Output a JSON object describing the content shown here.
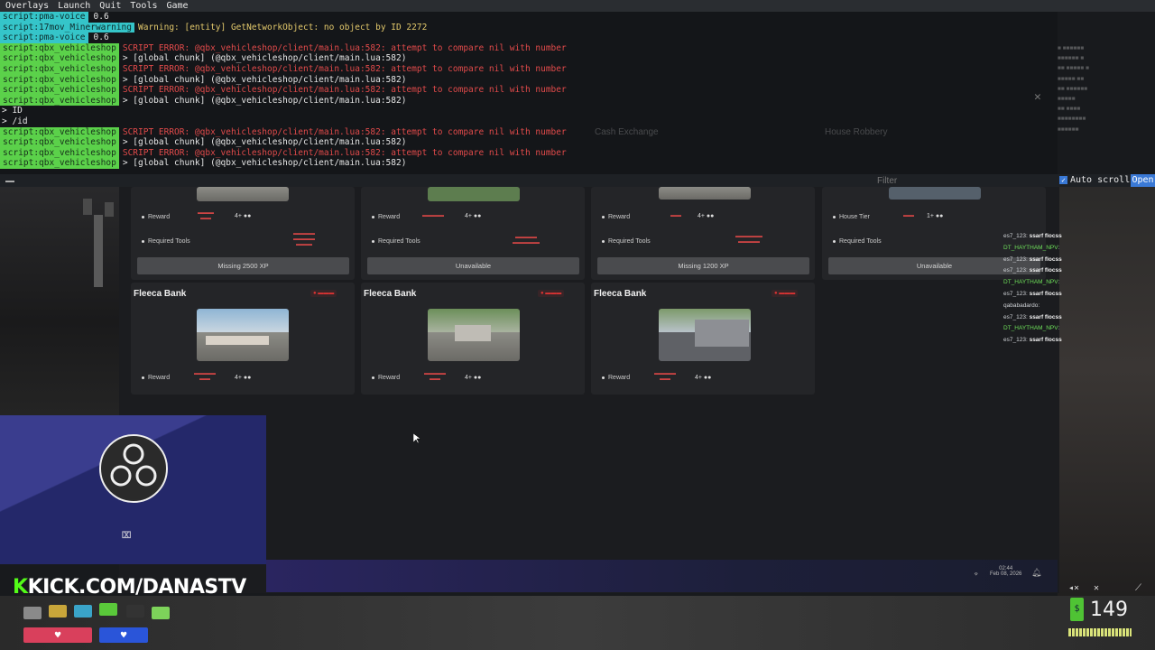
{
  "menu": [
    "Overlays",
    "Launch",
    "Quit",
    "Tools",
    "Game"
  ],
  "console": {
    "lines": [
      {
        "tag": "script:pma-voice",
        "tag_color": "cyan",
        "text": "0.6",
        "kind": "plain"
      },
      {
        "tag": "script:17mov_Minerwarning",
        "tag_color": "cyan",
        "text": "Warning: [entity] GetNetworkObject: no object by ID 2272",
        "kind": "warn"
      },
      {
        "tag": "script:pma-voice",
        "tag_color": "cyan",
        "text": "0.6",
        "kind": "plain"
      },
      {
        "tag": "script:qbx_vehicleshop",
        "tag_color": "green",
        "text": "SCRIPT ERROR: @qbx_vehicleshop/client/main.lua:582: attempt to compare nil with number",
        "kind": "err"
      },
      {
        "tag": "script:qbx_vehicleshop",
        "tag_color": "green",
        "text": "> [global chunk] (@qbx_vehicleshop/client/main.lua:582)",
        "kind": "chunk"
      },
      {
        "tag": "script:qbx_vehicleshop",
        "tag_color": "green",
        "text": "SCRIPT ERROR: @qbx_vehicleshop/client/main.lua:582: attempt to compare nil with number",
        "kind": "err"
      },
      {
        "tag": "script:qbx_vehicleshop",
        "tag_color": "green",
        "text": "> [global chunk] (@qbx_vehicleshop/client/main.lua:582)",
        "kind": "chunk"
      },
      {
        "tag": "script:qbx_vehicleshop",
        "tag_color": "green",
        "text": "SCRIPT ERROR: @qbx_vehicleshop/client/main.lua:582: attempt to compare nil with number",
        "kind": "err"
      },
      {
        "tag": "script:qbx_vehicleshop",
        "tag_color": "green",
        "text": "> [global chunk] (@qbx_vehicleshop/client/main.lua:582)",
        "kind": "chunk"
      },
      {
        "tag": "",
        "tag_color": "",
        "text": "> ID",
        "kind": "plain"
      },
      {
        "tag": "",
        "tag_color": "",
        "text": "> /id",
        "kind": "plain"
      },
      {
        "tag": "script:qbx_vehicleshop",
        "tag_color": "green",
        "text": "SCRIPT ERROR: @qbx_vehicleshop/client/main.lua:582: attempt to compare nil with number",
        "kind": "err"
      },
      {
        "tag": "script:qbx_vehicleshop",
        "tag_color": "green",
        "text": "> [global chunk] (@qbx_vehicleshop/client/main.lua:582)",
        "kind": "chunk"
      },
      {
        "tag": "script:qbx_vehicleshop",
        "tag_color": "green",
        "text": "SCRIPT ERROR: @qbx_vehicleshop/client/main.lua:582: attempt to compare nil with number",
        "kind": "err"
      },
      {
        "tag": "script:qbx_vehicleshop",
        "tag_color": "green",
        "text": "> [global chunk] (@qbx_vehicleshop/client/main.lua:582)",
        "kind": "chunk"
      }
    ],
    "filter_placeholder": "Filter",
    "auto_scroll_label": "Auto scroll",
    "open_label": "Open"
  },
  "overlay_headers": [
    "Cash Exchange",
    "House Robbery"
  ],
  "cards_top": [
    {
      "reward_label": "Reward",
      "crew": "4+",
      "tools_label": "Required Tools",
      "button": "Missing 2500 XP"
    },
    {
      "reward_label": "Reward",
      "crew": "4+",
      "tools_label": "Required Tools",
      "button": "Unavailable"
    },
    {
      "reward_label": "Reward",
      "crew": "4+",
      "tools_label": "Required Tools",
      "button": "Missing 1200 XP"
    },
    {
      "reward_label": "House Tier",
      "crew": "1+",
      "tools_label": "Required Tools",
      "button": "Unavailable"
    }
  ],
  "cards_bottom": [
    {
      "title": "Fleeca Bank",
      "reward_label": "Reward",
      "crew": "4+"
    },
    {
      "title": "Fleeca Bank",
      "reward_label": "Reward",
      "crew": "4+"
    },
    {
      "title": "Fleeca Bank",
      "reward_label": "Reward",
      "crew": "4+"
    }
  ],
  "chat": [
    {
      "user": "es7_123",
      "msg": "ssarf flocss",
      "green": false
    },
    {
      "user": "DT_HAYTHAM_NPV",
      "msg": "",
      "green": true
    },
    {
      "user": "es7_123",
      "msg": "ssarf flocss",
      "green": false
    },
    {
      "user": "es7_123",
      "msg": "ssarf flocss",
      "green": false
    },
    {
      "user": "DT_HAYTHAM_NPV",
      "msg": "",
      "green": true
    },
    {
      "user": "es7_123",
      "msg": "ssarf flocss",
      "green": false
    },
    {
      "user": "qababadardo",
      "msg": "",
      "green": false
    },
    {
      "user": "es7_123",
      "msg": "ssarf flocss",
      "green": false
    },
    {
      "user": "DT_HAYTHAM_NPV",
      "msg": "",
      "green": true
    },
    {
      "user": "es7_123",
      "msg": "ssarf flocss",
      "green": false
    }
  ],
  "stream": {
    "kick_k": "K",
    "kick_text": "KICK.COM/DANASTV"
  },
  "hud": {
    "number": "149",
    "money_symbol": "$"
  },
  "taskbar": {
    "time": "02:44",
    "date": "Feb 08, 2026"
  },
  "colors": {
    "kick_green": "#53fc18",
    "console_tag": "#5bd14a",
    "error_red": "#e04a4a",
    "accent_blue": "#3a79d6"
  }
}
